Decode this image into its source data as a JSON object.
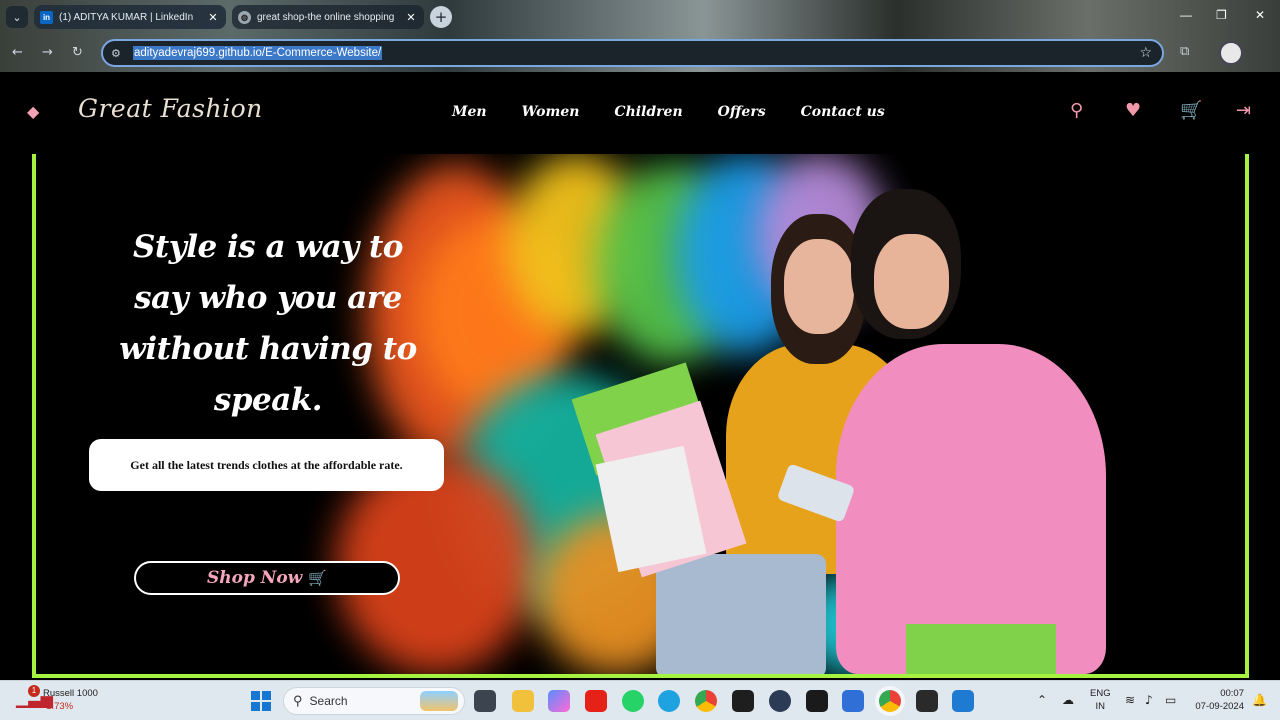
{
  "browser": {
    "tabs": [
      {
        "title": "(1) ADITYA KUMAR | LinkedIn",
        "favicon": "linkedin-icon"
      },
      {
        "title": "great shop-the online shopping",
        "favicon": "globe-icon"
      }
    ],
    "url": "adityadevraj699.github.io/E-Commerce-Website/"
  },
  "site": {
    "brand": "Great Fashion",
    "nav": [
      "Men",
      "Women",
      "Children",
      "Offers",
      "Contact us"
    ],
    "icons": [
      "search-icon",
      "heart-icon",
      "cart-icon",
      "login-icon"
    ]
  },
  "hero": {
    "title": "Style is a way to say who you are without having to speak.",
    "tagline": "Get all the latest trends clothes at the affordable rate.",
    "cta": "Shop Now",
    "border_color": "#a6f241"
  },
  "taskbar": {
    "widget_title": "Russell 1000",
    "widget_change": "-1.73%",
    "widget_badge": "1",
    "search_placeholder": "Search",
    "lang_line1": "ENG",
    "lang_line2": "IN",
    "time": "00:07",
    "date": "07-09-2024"
  }
}
